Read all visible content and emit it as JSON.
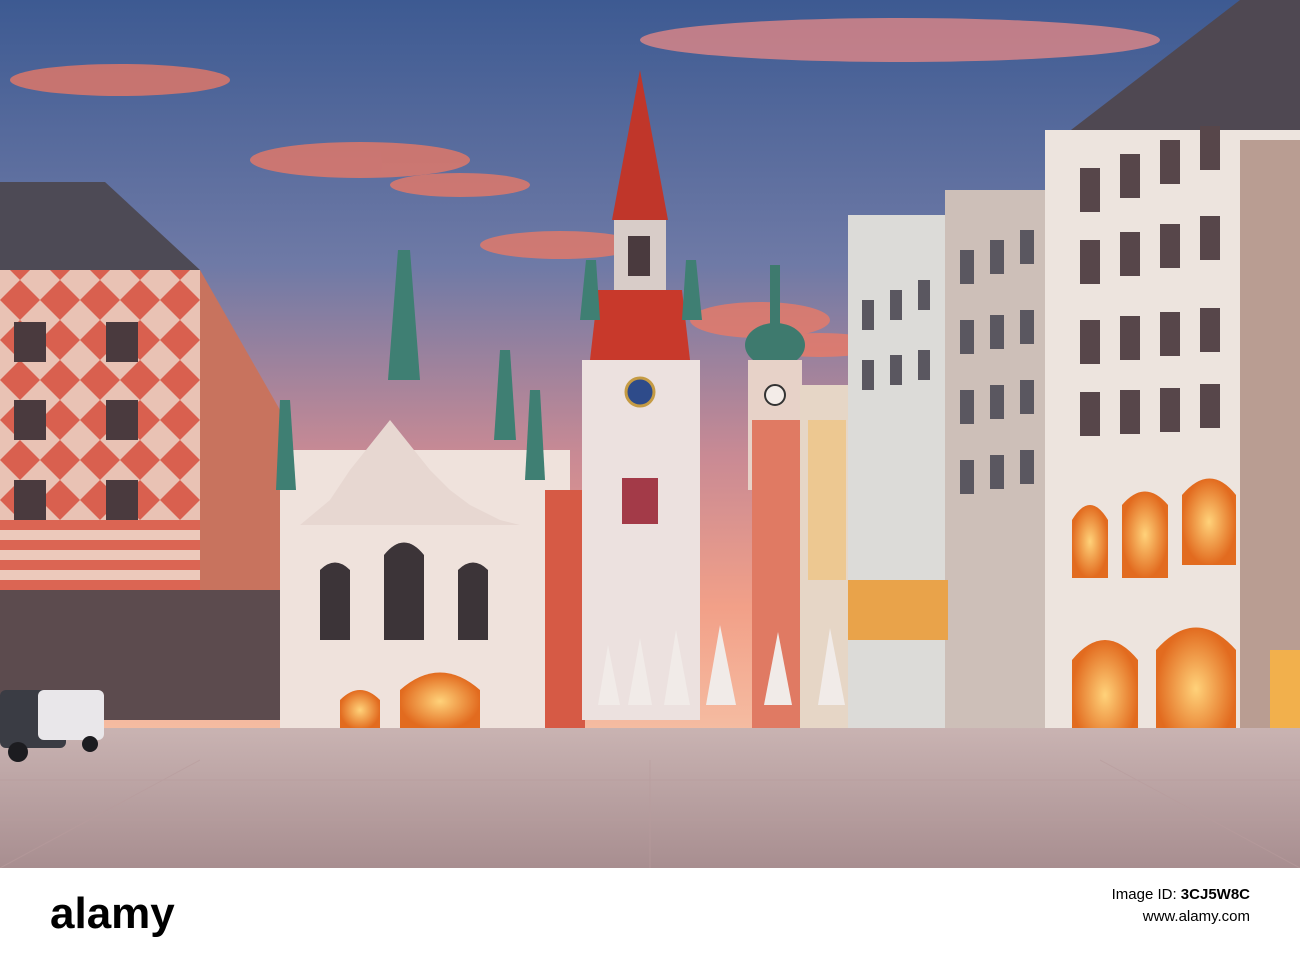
{
  "photo": {
    "subject": "Old Town Hall tower and gabled hall on a paved square at sunrise",
    "watermark": "alamy"
  },
  "footer": {
    "logo": "alamy",
    "image_id_label": "Image ID:",
    "image_id": "3CJ5W8C",
    "url": "www.alamy.com"
  },
  "colors": {
    "sky_top": "#3f5a8e",
    "sky_glow": "#f08a6a",
    "facade_red": "#d86a5a",
    "tower_roof": "#c8392b",
    "warm_light": "#ffb347"
  }
}
